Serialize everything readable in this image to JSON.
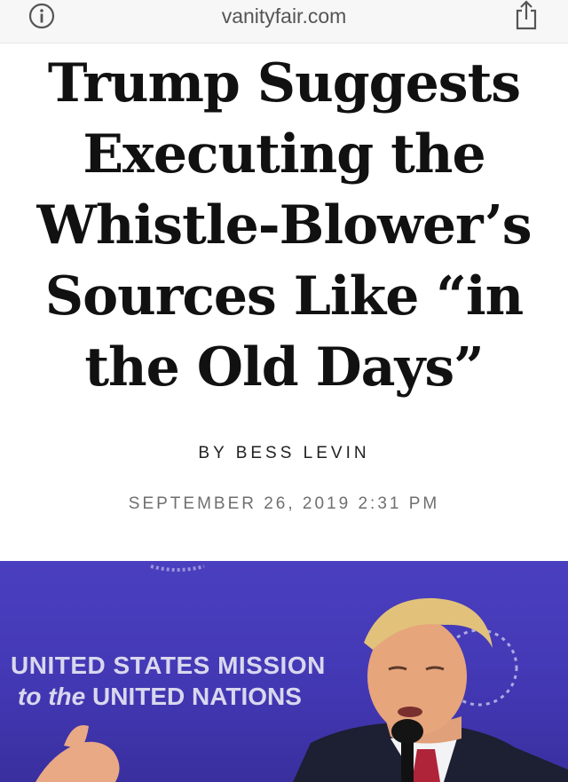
{
  "browser": {
    "url": "vanityfair.com",
    "info_icon": "info-icon",
    "share_icon": "share-icon"
  },
  "article": {
    "headline_lines": [
      "Trump Suggests",
      "Executing the",
      "Whistle-Blower’s",
      "Sources Like “in",
      "the Old Days”"
    ],
    "byline": "BY BESS LEVIN",
    "date": "SEPTEMBER 26, 2019 2:31 PM"
  },
  "hero": {
    "sign_line1": "UNITED STATES MISSION",
    "sign_line2_prefix": "to the",
    "sign_line2_suffix": "UNITED NATIONS",
    "colors": {
      "backdrop": "#4338b4",
      "sign_text": "#d9d7ee"
    }
  }
}
